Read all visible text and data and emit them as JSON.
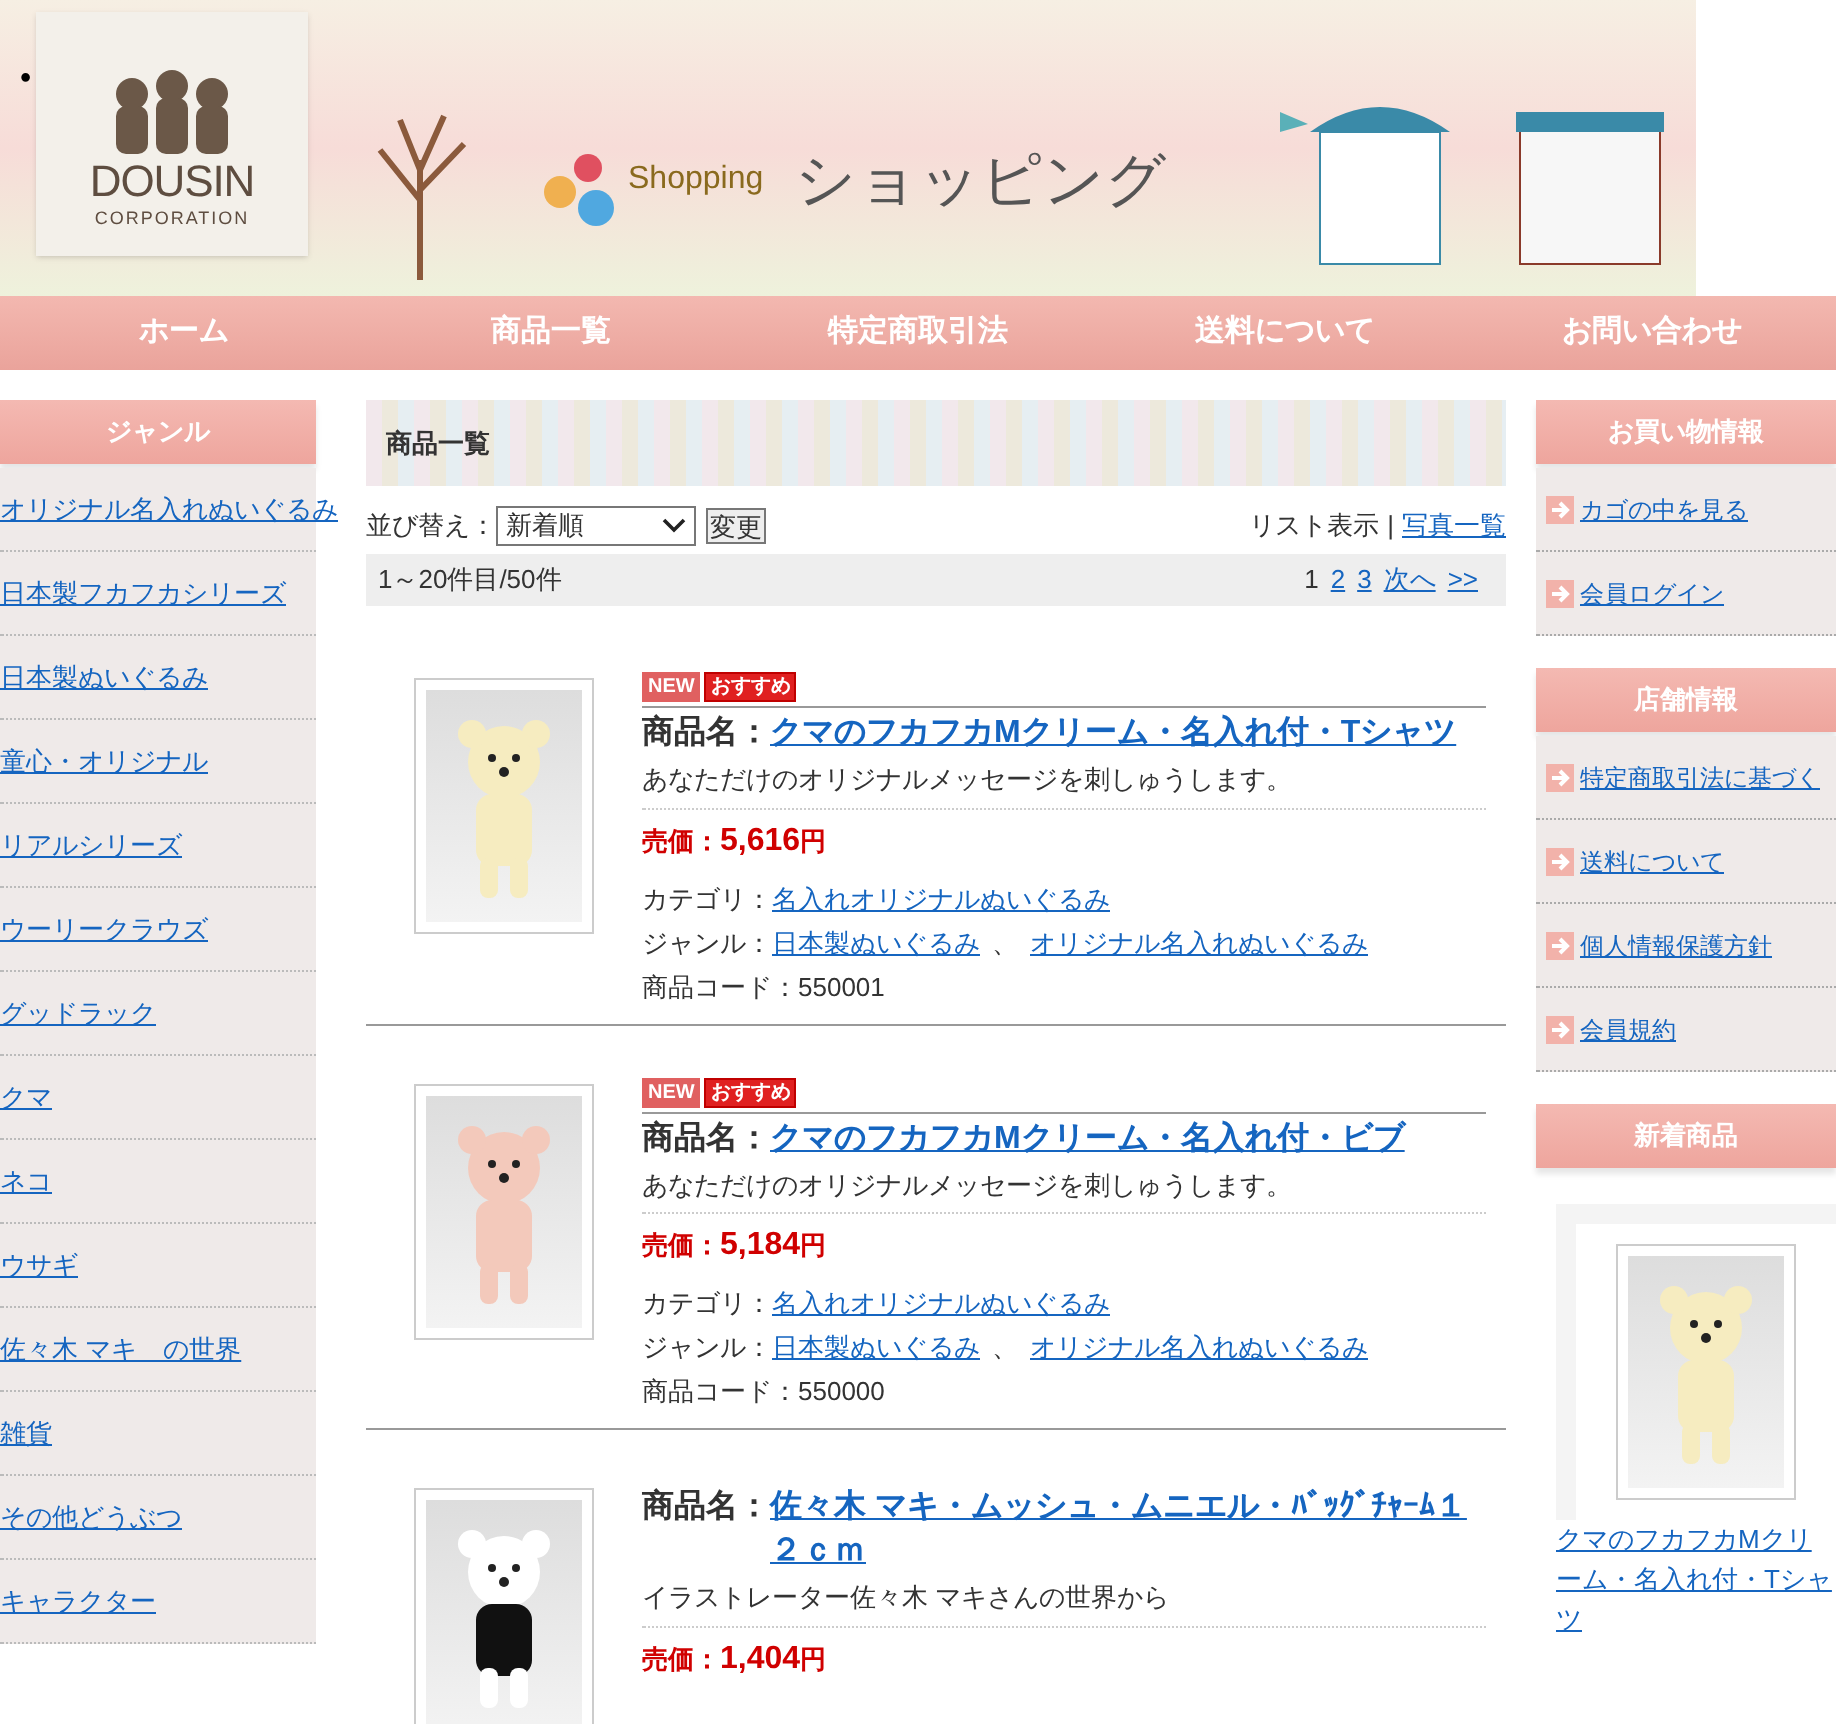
{
  "header": {
    "bullet": "•",
    "logo": {
      "name": "DOUSIN",
      "sub": "CORPORATION"
    },
    "tagline": "Shopping",
    "title": "ショッピング"
  },
  "nav": [
    "ホーム",
    "商品一覧",
    "特定商取引法",
    "送料について",
    "お問い合わせ"
  ],
  "left_sidebar": {
    "title": "ジャンル",
    "items": [
      "オリジナル名入れぬいぐるみ",
      "日本製フカフカシリーズ",
      "日本製ぬいぐるみ",
      "童心・オリジナル",
      "リアルシリーズ",
      "ウーリークラウズ",
      "グッドラック",
      "クマ",
      "ネコ",
      "ウサギ",
      "佐々木 マキ　の世界",
      "雑貨",
      "その他どうぶつ",
      "キャラクター"
    ]
  },
  "main": {
    "title": "商品一覧",
    "sort": {
      "label": "並び替え：",
      "value": "新着順",
      "button": "変更"
    },
    "view": {
      "current": "リスト表示",
      "separator": "|",
      "link": "写真一覧"
    },
    "count": "1～20件目/50件",
    "pagination": [
      {
        "label": "1",
        "selected": true
      },
      {
        "label": "2",
        "selected": false
      },
      {
        "label": "3",
        "selected": false
      },
      {
        "label": "次へ",
        "selected": false
      },
      {
        "label": ">>",
        "selected": false
      }
    ],
    "products": [
      {
        "badges": [
          {
            "kind": "new",
            "label": "NEW"
          },
          {
            "kind": "recommend",
            "label": "おすすめ"
          }
        ],
        "name_label": "商品名：",
        "name": "クマのフカフカMクリーム・名入れ付・Tシャツ",
        "description": "あなただけのオリジナルメッセージを刺しゅうします。",
        "price_label": "売価：",
        "price": "5,616",
        "unit": "円",
        "category_label": "カテゴリ：",
        "categories": [
          "名入れオリジナルぬいぐるみ"
        ],
        "genre_label": "ジャンル：",
        "genres": [
          "日本製ぬいぐるみ",
          "オリジナル名入れぬいぐるみ"
        ],
        "genre_sep": "、",
        "code": "商品コード：550001"
      },
      {
        "badges": [
          {
            "kind": "new",
            "label": "NEW"
          },
          {
            "kind": "recommend",
            "label": "おすすめ"
          }
        ],
        "name_label": "商品名：",
        "name": "クマのフカフカMクリーム・名入れ付・ビブ",
        "description": "あなただけのオリジナルメッセージを刺しゅうします。",
        "price_label": "売価：",
        "price": "5,184",
        "unit": "円",
        "category_label": "カテゴリ：",
        "categories": [
          "名入れオリジナルぬいぐるみ"
        ],
        "genre_label": "ジャンル：",
        "genres": [
          "日本製ぬいぐるみ",
          "オリジナル名入れぬいぐるみ"
        ],
        "genre_sep": "、",
        "code": "商品コード：550000"
      },
      {
        "name_label": "商品名：",
        "name": "佐々木 マキ・ムッシュ・ムニエル・ﾊﾞｯｸﾞﾁｬｰﾑ１２ｃｍ",
        "description": "イラストレーター佐々木 マキさんの世界から",
        "price_label": "売価：",
        "price": "1,404",
        "unit": "円"
      }
    ]
  },
  "right_sidebar": {
    "shopping": {
      "title": "お買い物情報",
      "items": [
        "カゴの中を見る",
        "会員ログイン"
      ]
    },
    "shop": {
      "title": "店舗情報",
      "items": [
        "特定商取引法に基づく",
        "送料について",
        "個人情報保護方針",
        "会員規約"
      ]
    },
    "new_items": {
      "title": "新着商品",
      "items": [
        {
          "name": "クマのフカフカMクリーム・名入れ付・Tシャツ"
        }
      ]
    }
  }
}
